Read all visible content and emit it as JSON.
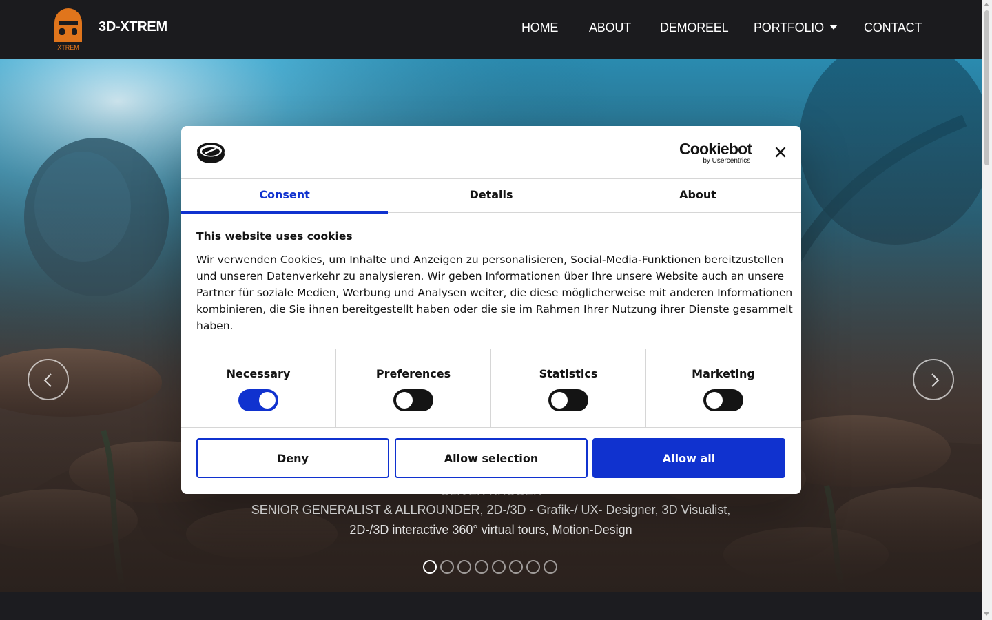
{
  "header": {
    "logo_text": "XTREM",
    "brand": "3D-XTREM",
    "nav": {
      "home": "HOME",
      "about": "ABOUT",
      "demoreel": "DEMOREEL",
      "portfolio": "PORTFOLIO",
      "contact": "CONTACT"
    }
  },
  "hero": {
    "name_partial": "OLIVER KRÜGER",
    "line1": "SENIOR GENERALIST & ALLROUNDER, 2D-/3D - Grafik-/ UX- Designer, 3D Visualist,",
    "line2": "2D-/3D interactive 360° virtual tours, Motion-Design",
    "slides": {
      "total": 8,
      "active_index": 0
    }
  },
  "cookie_dialog": {
    "brand_name": "Cookiebot",
    "brand_sub": "by Usercentrics",
    "tabs": [
      "Consent",
      "Details",
      "About"
    ],
    "active_tab": "Consent",
    "title": "This website uses cookies",
    "text": "Wir verwenden Cookies, um Inhalte und Anzeigen zu personalisieren, Social-Media-Funktionen bereitzustellen und unseren Datenverkehr zu analysieren. Wir geben Informationen über Ihre unsere Website auch an unsere Partner für soziale Medien, Werbung und Analysen weiter, die diese möglicherweise mit anderen Informationen kombinieren, die Sie ihnen bereitgestellt haben oder die sie im Rahmen Ihrer Nutzung ihrer Dienste gesammelt haben.",
    "categories": [
      {
        "label": "Necessary",
        "enabled": true
      },
      {
        "label": "Preferences",
        "enabled": false
      },
      {
        "label": "Statistics",
        "enabled": false
      },
      {
        "label": "Marketing",
        "enabled": false
      }
    ],
    "buttons": {
      "deny": "Deny",
      "allow_selection": "Allow selection",
      "allow_all": "Allow all"
    }
  },
  "colors": {
    "accent": "#1032cf",
    "header_bg": "#1b1b1e",
    "logo_orange": "#e0751c"
  },
  "icons": {
    "prev": "chevron-left-icon",
    "next": "chevron-right-icon",
    "close": "close-icon",
    "caret": "caret-down-icon"
  }
}
